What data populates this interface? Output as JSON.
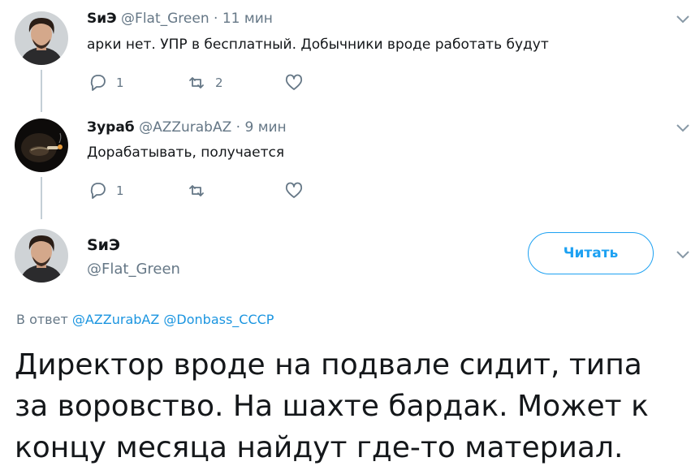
{
  "tweets": [
    {
      "name": "SиЭ",
      "handle": "@Flat_Green",
      "separator": "·",
      "time": "11 мин",
      "text": "арки нет. УПР в бесплатный. Добычники вроде работать будут",
      "replies": "1",
      "retweets": "2",
      "likes": ""
    },
    {
      "name": "Зураб",
      "handle": "@AZZurabAZ",
      "separator": "·",
      "time": "9 мин",
      "text": "Дорабатывать, получается",
      "replies": "1",
      "retweets": "",
      "likes": ""
    }
  ],
  "main": {
    "name": "SиЭ",
    "handle": "@Flat_Green",
    "follow_label": "Читать",
    "reply_prefix": "В ответ",
    "mentions": [
      "@AZZurabAZ",
      "@Donbass_CCCP"
    ],
    "text": "Директор вроде на подвале сидит, типа за воровство. На шахте бардак. Может к концу месяца найдут где-то материал."
  },
  "colors": {
    "accent": "#1da1f2",
    "muted": "#657786",
    "thread_line": "#c4cfd6"
  },
  "icons": [
    "reply-icon",
    "retweet-icon",
    "like-icon",
    "chevron-down-icon"
  ]
}
